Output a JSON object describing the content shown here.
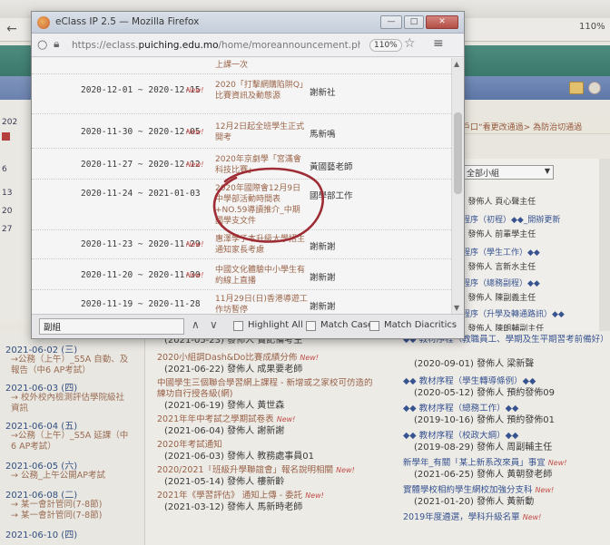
{
  "background": {
    "zoom": "110%",
    "left_strip": {
      "numbers": [
        "202",
        "6",
        "13",
        "20",
        "27"
      ]
    },
    "announce_banner": "戶口“看更改通過> 為防治切通過",
    "select_value": "全部小組",
    "right_rows": [
      {
        "text": ") 發佈人 頁心聲主任"
      },
      {
        "text": "程序（初程）◆◆_開辦更新",
        "diamond": true
      },
      {
        "text": ") 發佈人 前輩學主任"
      },
      {
        "text": "程序（學生工作）◆◆",
        "diamond": true
      },
      {
        "text": ") 發佈人 言新水主任"
      },
      {
        "text": "程序（總務副程）◆◆",
        "diamond": true
      },
      {
        "text": ") 發佈人 陳副義主任"
      },
      {
        "text": "程序（升學及轉通路訊）◆◆",
        "diamond": true
      },
      {
        "text": ") 發佈人 陳朗輔副主任"
      }
    ],
    "left_column": [
      {
        "label": "2021-06-02 (三)",
        "sub": []
      },
      {
        "label": "",
        "sub": [
          "→公務（上午）_S5A 自動、及",
          "報告（中6 AP考試）"
        ]
      },
      {
        "label": "2021-06-03 (四)",
        "sub": [
          "→ 校外校內檢測評估學院級社",
          "資訊"
        ]
      },
      {
        "label": "2021-06-04 (五)",
        "sub": [
          "→公務（上午）_S5A 延課（中",
          "6 AP考試）"
        ]
      },
      {
        "label": "2021-06-05 (六)",
        "sub": [
          "→ 公務_上午公開AP考試"
        ]
      },
      {
        "label": "2021-06-08 (二)",
        "sub": [
          "→ 某一會計管同(7-8節)",
          "→ 某一會計管同(7-8節)"
        ]
      },
      {
        "label": "2021-06-10 (四)",
        "sub": []
      }
    ],
    "mid_items": [
      {
        "title": "(2021-05-23) 發佈人 賣記備考生",
        "meta": ""
      },
      {
        "title": "2020小組調Dash&Do比賽成績分佈",
        "meta": "(2021-06-22) 發佈人 成果要老師",
        "new": true
      },
      {
        "title": "中國學生三個聯合學習網上課程 - 新增或之家校可仿造的",
        "meta": "",
        "new": false
      },
      {
        "title": "練功自行授各級(網)",
        "meta": "(2021-06-19) 發佈人 黃世森",
        "new": false
      },
      {
        "title": "2021年年中考試之學期試卷表",
        "meta": "(2021-06-04) 發佈人 謝新謝",
        "new": true
      },
      {
        "title": "2020年考試通知",
        "meta": "(2021-06-03) 發佈人 教務處事員01",
        "new": false
      },
      {
        "title": "2020/2021「班級升學聯誼會」報名說明相關",
        "meta": "(2021-05-14) 發佈人 樓新齡",
        "new": true
      },
      {
        "title": "2021年《學習評估》 通知上傳 - 委託",
        "meta": "(2021-03-12) 發佈人 馬新時老師",
        "new": true
      }
    ],
    "right_items": [
      {
        "title": "◆◆ 教材序程（教職員工、學期及生平期習考前備好）",
        "meta": ""
      },
      {
        "title": "",
        "meta": "(2020-09-01) 發佈人 梁新聲"
      },
      {
        "title": "◆◆ 教材序程（學生轉導條例）◆◆",
        "meta": "(2020-05-12) 發佈人 預約發佈09"
      },
      {
        "title": "◆◆ 教材序程（總務工作）◆◆",
        "meta": "(2019-10-16) 發佈人 預約發佈01"
      },
      {
        "title": "◆◆ 教材序程（校政大綱）◆◆",
        "meta": "(2019-08-29) 發佈人 周副輔主任"
      },
      {
        "title": "新學年_有關「某上新系改來員」事宜",
        "meta": "(2021-06-25) 發佈人 黃朝發老師",
        "new": true
      },
      {
        "title": "實體學校相約學生網校加強分支科",
        "meta": "(2021-01-20) 發佈人 黃新動",
        "new": true
      },
      {
        "title": "2019年度遴選，學科升級名單",
        "meta": "",
        "new": true
      }
    ]
  },
  "popup": {
    "window_title": "eClass IP 2.5 — Mozilla Firefox",
    "url_prefix": "https://eclass.",
    "url_domain": "puiching.edu.mo",
    "url_suffix": "/home/moreannouncement.php?type=C",
    "zoom": "110%",
    "new_label": "New!",
    "announcements": [
      {
        "date": "",
        "new": false,
        "title": "上課一次",
        "author": ""
      },
      {
        "date": "2020-12-01 ~ 2020-12-15",
        "new": true,
        "title": "2020「打擊網購陷阱Q」比賽資訊及動態源",
        "author": "謝新社"
      },
      {
        "date": "2020-11-30 ~ 2020-12-05",
        "new": true,
        "title": "12月2日起全班學生正式開考",
        "author": "馬新鳴"
      },
      {
        "date": "2020-11-27 ~ 2020-12-12",
        "new": true,
        "title": "2020年京劇學「宮滿會科技比賽」",
        "author": "黃國藝老師"
      },
      {
        "date": "2020-11-24 ~ 2021-01-03",
        "new": false,
        "title": "2020年國際會12月9日中學部活動時間表+NO.59導讀推介_中期國學支文件",
        "author": "國學部工作"
      },
      {
        "date": "2020-11-23 ~ 2020-11-29",
        "new": true,
        "title": "惠澤學子本升級大學招生通知家長考慮",
        "author": "謝新謝"
      },
      {
        "date": "2020-11-20 ~ 2020-11-30",
        "new": true,
        "title": "中國文化體驗中小學生有約線上直播",
        "author": "謝新謝"
      },
      {
        "date": "2020-11-19 ~ 2020-11-28",
        "new": false,
        "title": "11月29日(日)香港導遊工作坊暫停",
        "author": "謝新謝"
      }
    ],
    "find": {
      "value": "副組",
      "highlight_all": "Highlight All",
      "match_case": "Match Case",
      "match_diacritics": "Match Diacritics"
    }
  }
}
